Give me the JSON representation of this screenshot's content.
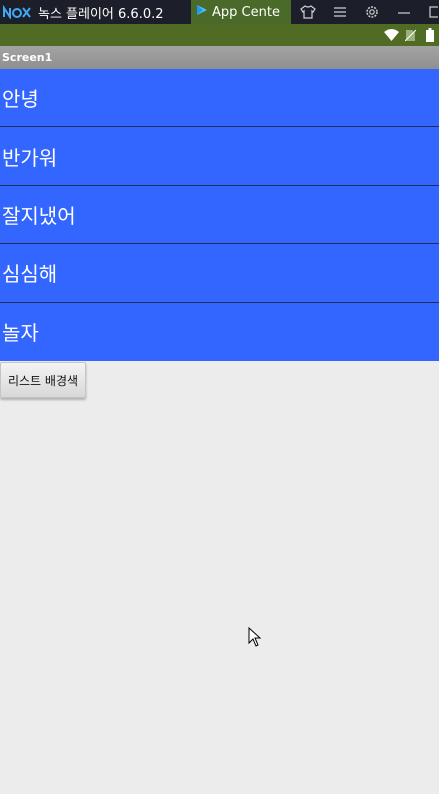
{
  "emulator": {
    "logo_text": "nox",
    "title": "녹스 플레이어 6.6.0.2",
    "app_center_tab": "App Cente"
  },
  "app": {
    "screen_title": "Screen1"
  },
  "list": {
    "items": [
      "안녕",
      "반가워",
      "잘지냈어",
      "심심해",
      "놀자"
    ],
    "background_color": "#3366ff"
  },
  "button": {
    "label": "리스트 배경색"
  },
  "colors": {
    "titlebar": "#1c1f2a",
    "statusbar": "#4f6b24",
    "app_background": "#ececec"
  }
}
